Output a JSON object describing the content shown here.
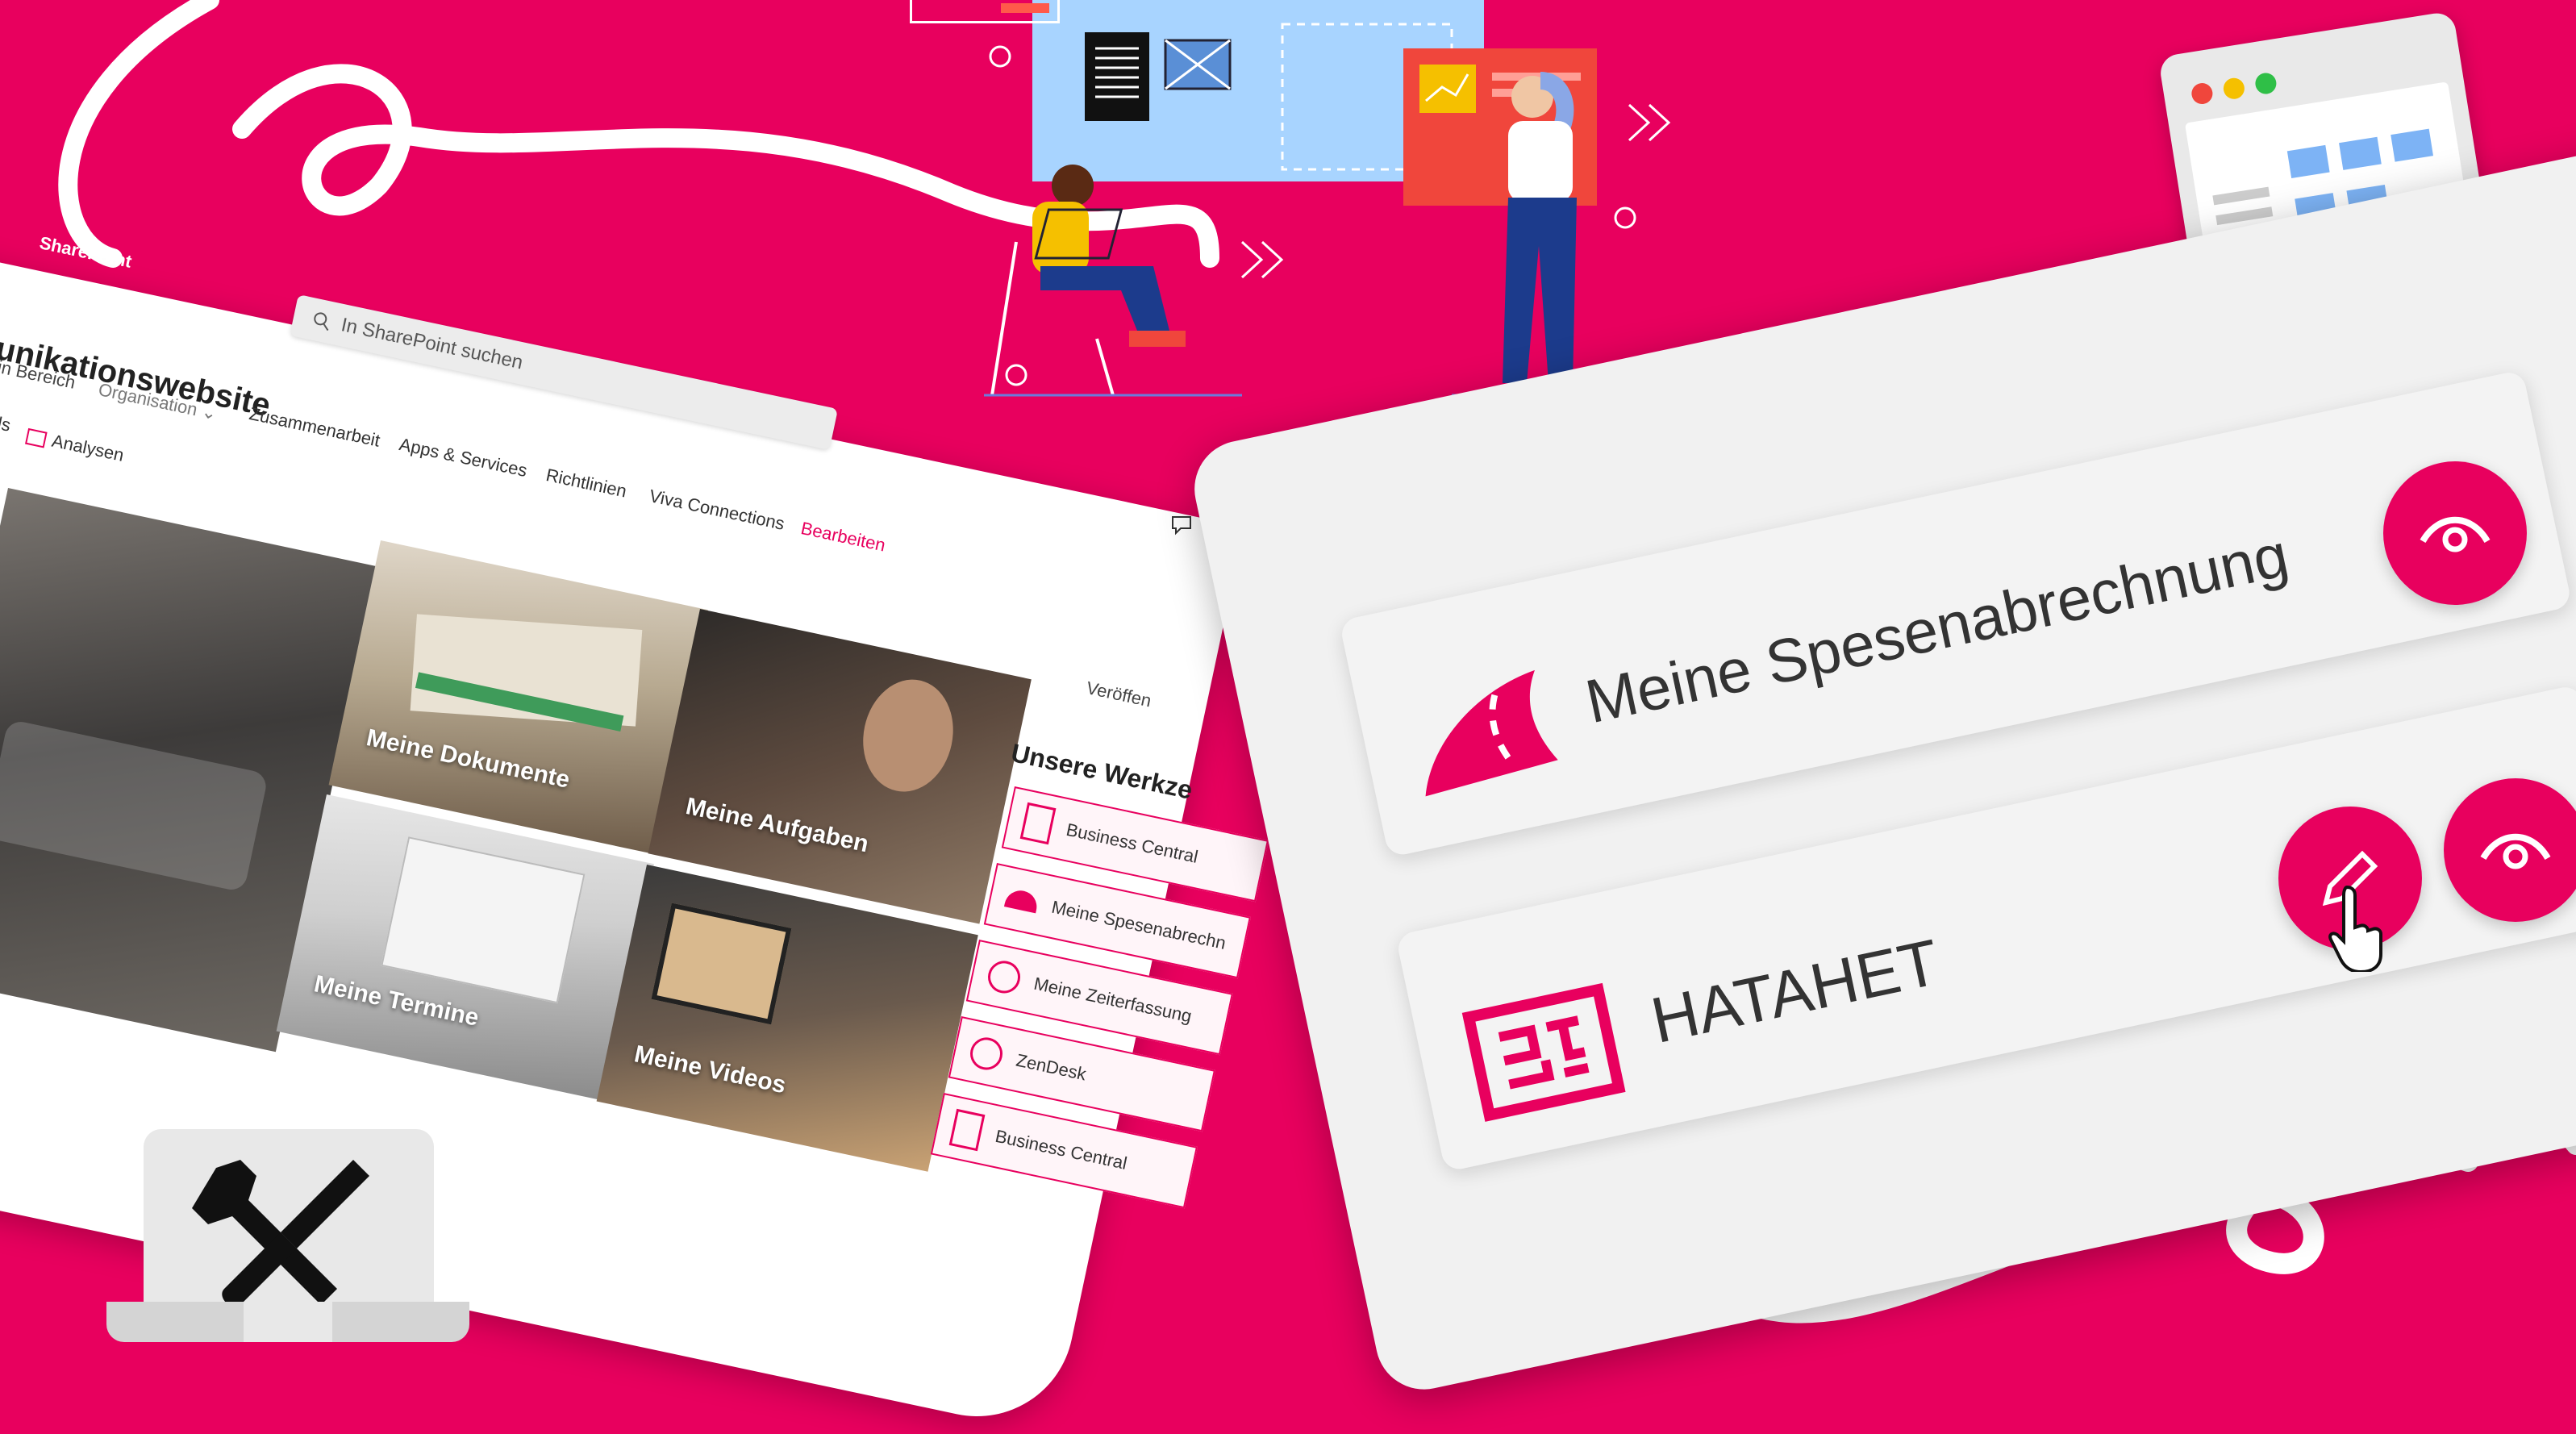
{
  "sharepoint": {
    "brand": "SharePoint",
    "search_placeholder": "In SharePoint suchen",
    "site_title": "unikationswebsite",
    "site_subtitle": "in Bereich",
    "org_label": "Organisation",
    "nav": [
      "ls",
      "Analysen",
      "Zusammenarbeit",
      "Apps & Services",
      "Richtlinien",
      "Viva Connections",
      "Bearbeiten"
    ],
    "published": "Veröffen",
    "tiles": [
      {
        "label": "Meine Dokumente"
      },
      {
        "label": "Meine Aufgaben"
      },
      {
        "label": "Meine Termine"
      },
      {
        "label": "Meine Videos"
      }
    ],
    "tools_heading": "Unsere Werkze",
    "tools": [
      {
        "label": "Business Central"
      },
      {
        "label": "Meine Spesenabrechn"
      },
      {
        "label": "Meine Zeiterfassung"
      },
      {
        "label": "ZenDesk"
      },
      {
        "label": "Business Central"
      }
    ]
  },
  "app_cards": [
    {
      "label": "Meine Spesenabrechnung",
      "icon": "road-icon"
    },
    {
      "label": "HATAHET",
      "icon": "hatahet-logo-icon"
    }
  ],
  "colors": {
    "brand": "#E8005E",
    "panel": "#f2f2f2",
    "text": "#333333"
  }
}
